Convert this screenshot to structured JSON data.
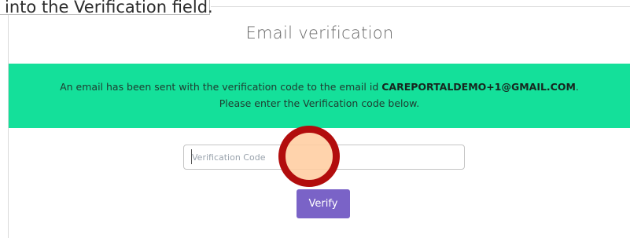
{
  "instruction": {
    "text": "into the Verification field."
  },
  "page": {
    "title": "Email verification"
  },
  "notice": {
    "prefix": "An email has been sent with the verification code to the email id ",
    "email": "CAREPORTALDEMO+1@GMAIL.COM",
    "suffix": ".",
    "line2": "Please enter the Verification code below."
  },
  "form": {
    "code_value": "",
    "code_placeholder": "Verification Code",
    "verify_label": "Verify"
  },
  "colors": {
    "banner": "#14e09a",
    "button": "#7a63c7",
    "click_marker_ring": "#b20d0d",
    "click_marker_fill": "#ffcda0"
  }
}
